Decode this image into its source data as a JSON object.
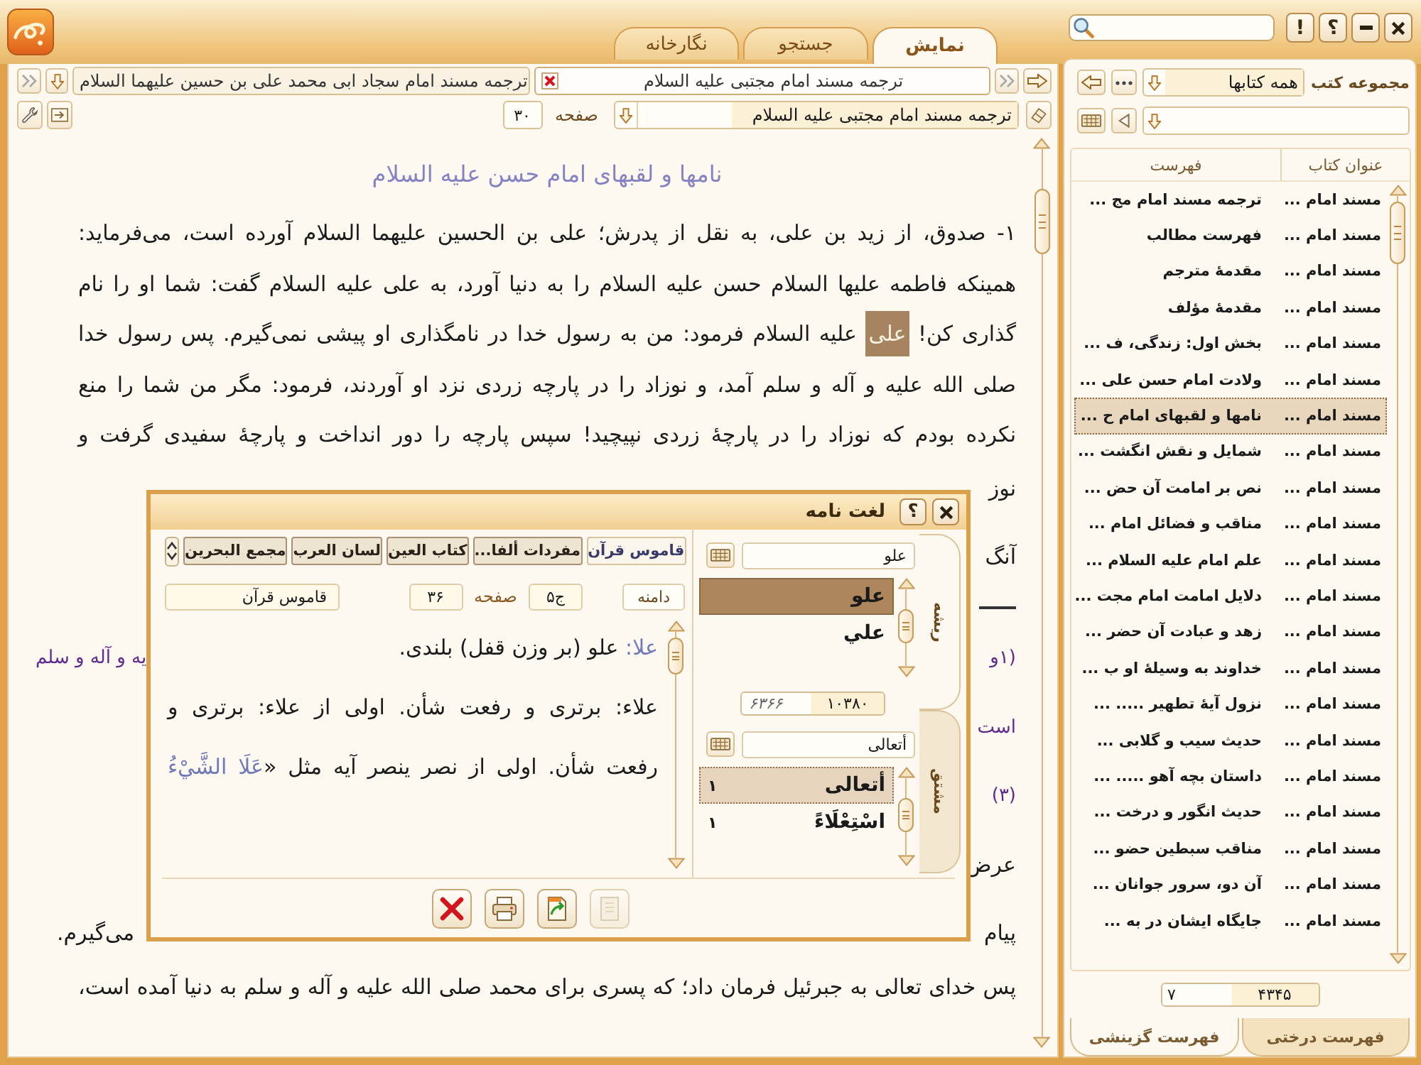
{
  "top_tabs": [
    {
      "label": "نمایش",
      "selected": true
    },
    {
      "label": "جستجو",
      "selected": false
    },
    {
      "label": "نگارخانه",
      "selected": false
    }
  ],
  "alert_button": "!",
  "help_button": "؟",
  "doc_tabs": [
    {
      "label": "ترجمه مسند امام مجتبی علیه السلام",
      "selected": true
    },
    {
      "label": "ترجمه مسند امام سجاد ابی محمد علی بن حسین علیهما السلام",
      "selected": false
    }
  ],
  "doc_bar": {
    "title": "ترجمه مسند امام مجتبی علیه السلام",
    "page_label": "صفحه",
    "page": "۳۰"
  },
  "reader": {
    "heading": "نامها و لقبهای امام حسن علیه السلام",
    "paragraph": [
      "۱- صدوق، از زید بن علی، به نقل از پدرش؛ علی بن الحسین علیهما السلام آورده است، می‌فرماید:",
      "همینکه فاطمه علیها السلام حسن علیه السلام را به دنیا آورد، به علی علیه السلام گفت: شما او را نام",
      "گذاری کن! **علی** علیه السلام فرمود: من به رسول خدا در نامگذاری او پیشی نمی‌گیرم. پس رسول خدا",
      "صلی الله علیه و آله و سلم آمد، و نوزاد را در پارچه زردی نزد او آوردند، فرمود: مگر من شما را منع",
      "نکرده بودم که نوزاد را در پارچهٔ زردی نپیچید! سپس پارچه را دور انداخت و پارچهٔ سفیدی گرفت و"
    ],
    "covered_lines": [
      {
        "kind": "text",
        "start": "نوز"
      },
      {
        "kind": "text",
        "start": "آنگ"
      },
      {
        "kind": "rule"
      },
      {
        "kind": "footnote",
        "start": "(۱و",
        "end": "یه و آله و سلم"
      },
      {
        "kind": "footnote",
        "start": "است"
      },
      {
        "kind": "footnote",
        "start": "(۳)"
      },
      {
        "kind": "text",
        "start": "عرض"
      },
      {
        "kind": "text",
        "start": "پیام",
        "end": "می‌گیرم."
      }
    ],
    "last_line": "پس خدای تعالی به جبرئیل فرمان داد؛ که پسری برای محمد صلی الله علیه و آله و سلم به دنیا آمده است،"
  },
  "library": {
    "label": "مجموعه کتب",
    "collection": "همه کتابها",
    "columns": [
      "عنوان کتاب",
      "فهرست"
    ],
    "rows": [
      {
        "book": "مسند امام ...",
        "entry": "ترجمه مسند امام مج ...",
        "selected": false
      },
      {
        "book": "مسند امام ...",
        "entry": "فهرست مطالب",
        "selected": false
      },
      {
        "book": "مسند امام ...",
        "entry": "مقدمهٔ مترجم",
        "selected": false
      },
      {
        "book": "مسند امام ...",
        "entry": "مقدمهٔ مؤلف",
        "selected": false
      },
      {
        "book": "مسند امام ...",
        "entry": "بخش اول: زندگی، ف ...",
        "selected": false
      },
      {
        "book": "مسند امام ...",
        "entry": "ولادت امام حسن علی ...",
        "selected": false
      },
      {
        "book": "مسند امام ...",
        "entry": "نامها و لقبهای امام ح ...",
        "selected": true
      },
      {
        "book": "مسند امام ...",
        "entry": "شمایل و نقش انگشت ...",
        "selected": false
      },
      {
        "book": "مسند امام ...",
        "entry": "نص بر امامت آن حض ...",
        "selected": false
      },
      {
        "book": "مسند امام ...",
        "entry": "مناقب و فضائل امام ...",
        "selected": false
      },
      {
        "book": "مسند امام ...",
        "entry": "علم امام علیه السلام ...",
        "selected": false
      },
      {
        "book": "مسند امام ...",
        "entry": "دلایل امامت امام مجت ...",
        "selected": false
      },
      {
        "book": "مسند امام ...",
        "entry": "زهد و عبادت آن حضر ...",
        "selected": false
      },
      {
        "book": "مسند امام ...",
        "entry": "خداوند به وسیلهٔ او ب ...",
        "selected": false
      },
      {
        "book": "مسند امام ...",
        "entry": "نزول آیهٔ تطهیر ..... ...",
        "selected": false
      },
      {
        "book": "مسند امام ...",
        "entry": "حدیث سیب و گلابی ...",
        "selected": false
      },
      {
        "book": "مسند امام ...",
        "entry": "داستان بچه آهو ..... ...",
        "selected": false
      },
      {
        "book": "مسند امام ...",
        "entry": "حدیث انگور و درخت ...",
        "selected": false
      },
      {
        "book": "مسند امام ...",
        "entry": "مناقب سبطین حضو ...",
        "selected": false
      },
      {
        "book": "مسند امام ...",
        "entry": "آن دو، سرور جوانان ...",
        "selected": false
      },
      {
        "book": "مسند امام ...",
        "entry": "جایگاه ایشان در به ...",
        "selected": false
      }
    ],
    "count_total": "۴۳۴۵",
    "count_shown": "۷",
    "tabs": [
      {
        "label": "فهرست درختی",
        "selected": false
      },
      {
        "label": "فهرست گزینشی",
        "selected": true
      }
    ]
  },
  "dictionary": {
    "title": "لغت نامه",
    "help": "؟",
    "sources": [
      {
        "label": "قاموس قرآن",
        "selected": true
      },
      {
        "label": "مفردات ألفا...",
        "selected": false
      },
      {
        "label": "کتاب العین",
        "selected": false
      },
      {
        "label": "لسان العرب",
        "selected": false
      },
      {
        "label": "مجمع البحرین",
        "selected": false
      }
    ],
    "range_label": "دامنه",
    "volume": "ج۵",
    "page_label": "صفحه",
    "page": "۳۶",
    "source_name": "قاموس قرآن",
    "entry": [
      {
        "lines": [
          "**علا:** علو (بر وزن قفل) بلندی."
        ]
      },
      {
        "lines": [
          "علاء: برتری و رفعت شأن. اولی از علاء: برتری و",
          "رفعت شأن. اولی از نصر ینصر آیه مثل «**عَلَا الشَّيْءُ**"
        ]
      }
    ],
    "root_field": "علو",
    "roots": [
      {
        "word": "علو",
        "selected": true
      },
      {
        "word": "علي",
        "selected": false
      }
    ],
    "root_count": "۱۰۳۸۰",
    "root_count_other": "۶۳۶۶",
    "derived_field": "أتعالی",
    "derived": [
      {
        "word": "أتعالی",
        "count": "۱",
        "selected": true
      },
      {
        "word": "اسْتِعْلَاءً",
        "count": "۱",
        "selected": false
      }
    ],
    "side_tabs": [
      {
        "label": "ریشه",
        "selected": true
      },
      {
        "label": "مشتق",
        "selected": false
      }
    ],
    "footer_buttons": [
      {
        "kind": "close",
        "disabled": false
      },
      {
        "kind": "print",
        "disabled": false
      },
      {
        "kind": "export",
        "disabled": false
      },
      {
        "kind": "page",
        "disabled": true
      }
    ]
  }
}
